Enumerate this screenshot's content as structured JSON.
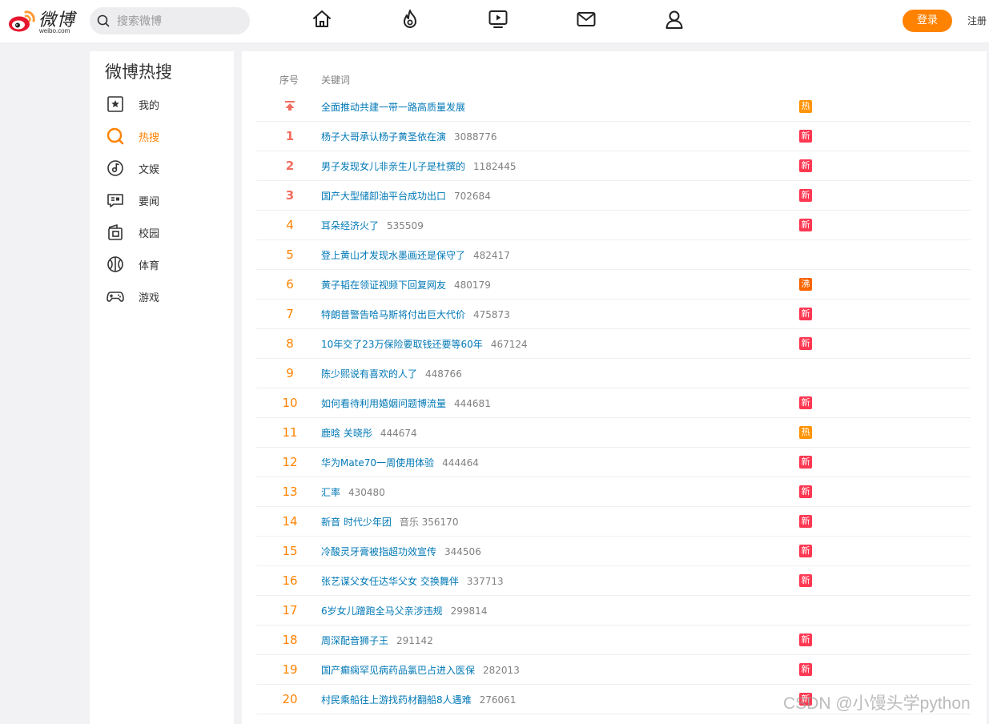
{
  "header": {
    "logo_text": "微博",
    "logo_sub": "weibo.com",
    "search_placeholder": "搜索微博",
    "nav": [
      "home-icon",
      "hot-icon",
      "video-icon",
      "message-icon",
      "user-icon"
    ],
    "login_label": "登录",
    "register_label": "注册",
    "accent_color": "#ff8200"
  },
  "sidebar": {
    "title": "微博热搜",
    "items": [
      {
        "label": "我的",
        "icon": "star-bookmark-icon"
      },
      {
        "label": "热搜",
        "icon": "hot-search-icon",
        "active": true
      },
      {
        "label": "文娱",
        "icon": "music-disc-icon"
      },
      {
        "label": "要闻",
        "icon": "news-icon"
      },
      {
        "label": "校园",
        "icon": "campus-icon"
      },
      {
        "label": "体育",
        "icon": "basketball-icon"
      },
      {
        "label": "游戏",
        "icon": "gamepad-icon"
      }
    ]
  },
  "table": {
    "col_rank": "序号",
    "col_keyword": "关键词",
    "pinned": {
      "keyword": "全面推动共建一带一路高质量发展",
      "badge": "热"
    },
    "rows": [
      {
        "rank": "1",
        "keyword": "杨子大哥承认杨子黄圣依在演",
        "hot": "3088776",
        "badge": "新"
      },
      {
        "rank": "2",
        "keyword": "男子发现女儿非亲生儿子是杜撰的",
        "hot": "1182445",
        "badge": "新"
      },
      {
        "rank": "3",
        "keyword": "国产大型储卸油平台成功出口",
        "hot": "702684",
        "badge": "新"
      },
      {
        "rank": "4",
        "keyword": "耳朵经济火了",
        "hot": "535509",
        "badge": "新"
      },
      {
        "rank": "5",
        "keyword": "登上黄山才发现水墨画还是保守了",
        "hot": "482417",
        "badge": ""
      },
      {
        "rank": "6",
        "keyword": "黄子韬在领证视频下回复网友",
        "hot": "480179",
        "badge": "沸"
      },
      {
        "rank": "7",
        "keyword": "特朗普警告哈马斯将付出巨大代价",
        "hot": "475873",
        "badge": "新"
      },
      {
        "rank": "8",
        "keyword": "10年交了23万保险要取钱还要等60年",
        "hot": "467124",
        "badge": "新"
      },
      {
        "rank": "9",
        "keyword": "陈少熙说有喜欢的人了",
        "hot": "448766",
        "badge": ""
      },
      {
        "rank": "10",
        "keyword": "如何看待利用婚姻问题博流量",
        "hot": "444681",
        "badge": "新"
      },
      {
        "rank": "11",
        "keyword": "鹿晗 关晓彤",
        "hot": "444674",
        "badge": "热"
      },
      {
        "rank": "12",
        "keyword": "华为Mate70一周使用体验",
        "hot": "444464",
        "badge": "新"
      },
      {
        "rank": "13",
        "keyword": "汇率",
        "hot": "430480",
        "badge": "新"
      },
      {
        "rank": "14",
        "keyword": "新音 时代少年团",
        "hot": "音乐 356170",
        "badge": "新"
      },
      {
        "rank": "15",
        "keyword": "冷酸灵牙膏被指超功效宣传",
        "hot": "344506",
        "badge": "新"
      },
      {
        "rank": "16",
        "keyword": "张艺谋父女任达华父女 交换舞伴",
        "hot": "337713",
        "badge": "新"
      },
      {
        "rank": "17",
        "keyword": "6岁女儿蹭跑全马父亲涉违规",
        "hot": "299814",
        "badge": ""
      },
      {
        "rank": "18",
        "keyword": "周深配音狮子王",
        "hot": "291142",
        "badge": "新"
      },
      {
        "rank": "19",
        "keyword": "国产癫痫罕见病药品氯巴占进入医保",
        "hot": "282013",
        "badge": "新"
      },
      {
        "rank": "20",
        "keyword": "村民乘船往上游找药材翻船8人遇难",
        "hot": "276061",
        "badge": "新"
      }
    ],
    "badge_colors": {
      "新": "#ff3852",
      "热": "#ff9406",
      "沸": "#f86400"
    }
  },
  "watermark": "CSDN @小馒头学python"
}
